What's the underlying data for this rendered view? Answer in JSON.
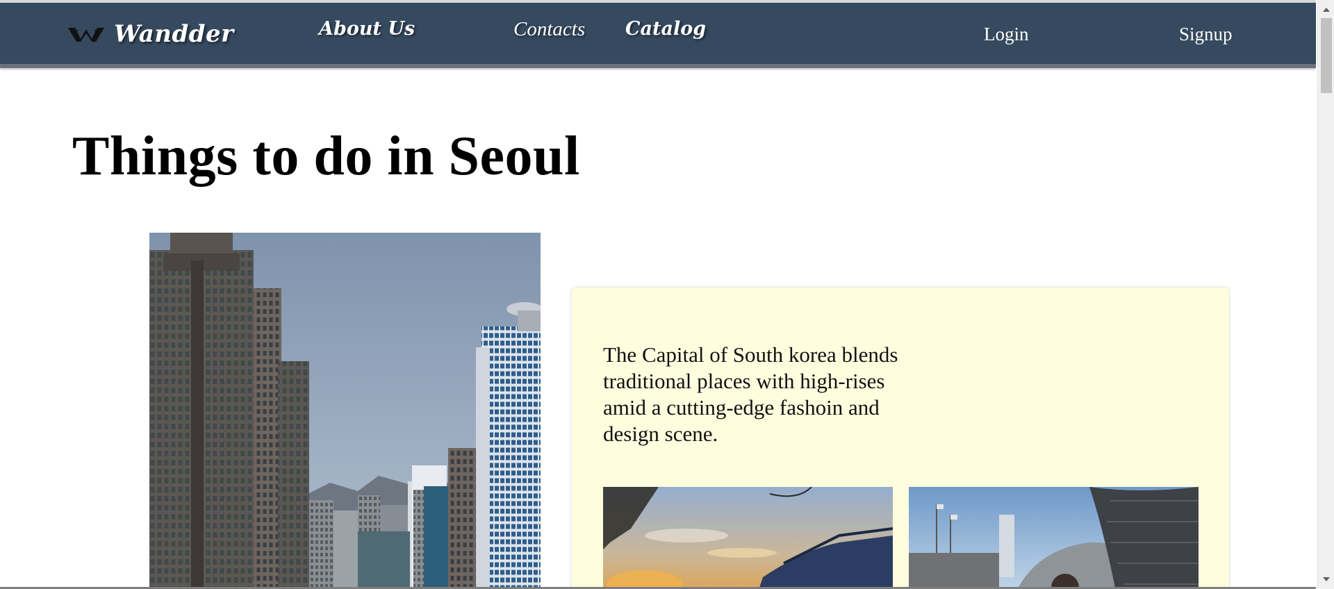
{
  "nav": {
    "brand": "Wandder",
    "logo_icon": "winged-w-logo-icon",
    "about": "About Us",
    "contacts": "Contacts",
    "catalog": "Catalog",
    "login": "Login",
    "signup": "Signup",
    "background_color": "#35495f"
  },
  "main": {
    "title": "Things to do in Seoul",
    "hero_image_subject": "seoul-skyscrapers-photo",
    "card": {
      "text": "The Capital of South korea blends traditional places with high-rises amid a cutting-edge fashoin and design scene.",
      "background_color": "#fefedf",
      "photos": [
        "palace-sunset-photo",
        "modern-architecture-photo"
      ]
    }
  },
  "scrollbar": {
    "up_icon": "scroll-up-arrow-icon",
    "down_icon": "scroll-down-arrow-icon"
  }
}
